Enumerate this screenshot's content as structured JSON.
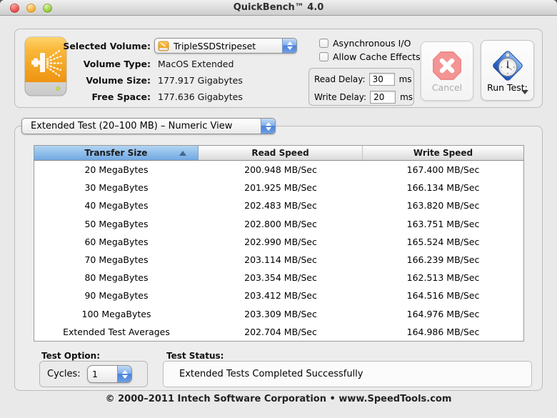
{
  "window": {
    "title": "QuickBench™ 4.0"
  },
  "volume_panel": {
    "selected_volume_label": "Selected Volume:",
    "selected_volume_value": "TripleSSDStripeset",
    "rows": [
      {
        "label": "Volume Type:",
        "value": "MacOS Extended"
      },
      {
        "label": "Volume Size:",
        "value": "177.917 Gigabytes"
      },
      {
        "label": "Free Space:",
        "value": "177.636 Gigabytes"
      }
    ]
  },
  "options": {
    "checkboxes": [
      {
        "label": "Asynchronous I/O",
        "checked": false
      },
      {
        "label": "Allow Cache Effects",
        "checked": false
      }
    ],
    "read_delay_label": "Read Delay:",
    "read_delay_value": "30",
    "write_delay_label": "Write Delay:",
    "write_delay_value": "20",
    "delay_unit": "ms"
  },
  "buttons": {
    "cancel_label": "Cancel",
    "run_test_label": "Run Test:"
  },
  "test_select": {
    "value": "Extended Test (20–100 MB) – Numeric View"
  },
  "results_table": {
    "type": "table",
    "headers": [
      "Transfer Size",
      "Read Speed",
      "Write Speed"
    ],
    "sorted_column": "Transfer Size",
    "rows": [
      [
        "20 MegaBytes",
        "200.948 MB/Sec",
        "167.400 MB/Sec"
      ],
      [
        "30 MegaBytes",
        "201.925 MB/Sec",
        "166.134 MB/Sec"
      ],
      [
        "40 MegaBytes",
        "202.483 MB/Sec",
        "163.820 MB/Sec"
      ],
      [
        "50 MegaBytes",
        "202.800 MB/Sec",
        "163.751 MB/Sec"
      ],
      [
        "60 MegaBytes",
        "202.990 MB/Sec",
        "165.524 MB/Sec"
      ],
      [
        "70 MegaBytes",
        "203.114 MB/Sec",
        "166.239 MB/Sec"
      ],
      [
        "80 MegaBytes",
        "203.354 MB/Sec",
        "162.513 MB/Sec"
      ],
      [
        "90 MegaBytes",
        "203.412 MB/Sec",
        "164.516 MB/Sec"
      ],
      [
        "100 MegaBytes",
        "203.309 MB/Sec",
        "164.976 MB/Sec"
      ],
      [
        "Extended Test Averages",
        "202.704 MB/Sec",
        "164.986 MB/Sec"
      ]
    ]
  },
  "test_option": {
    "label": "Test Option:",
    "cycles_label": "Cycles:",
    "cycles_value": "1"
  },
  "test_status": {
    "label": "Test Status:",
    "value": "Extended Tests Completed Successfully"
  },
  "footer": {
    "text": "© 2000–2011 Intech Software Corporation • www.SpeedTools.com"
  },
  "colors": {
    "accent_blue": "#4a82d8",
    "header_selected_blue": "#8cbcea",
    "drive_orange": "#f6a51c",
    "cancel_pink": "#f49595",
    "runtest_blue": "#2e6fd0"
  }
}
